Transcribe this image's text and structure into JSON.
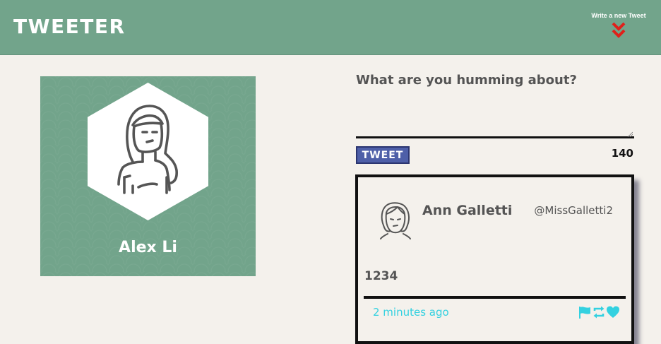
{
  "header": {
    "brand": "TWEETER",
    "compose_label": "Write a new Tweet",
    "compose_icon": "double-chevron-down-icon",
    "background_color": "#72a48b",
    "accent_color": "#e0201a"
  },
  "profile": {
    "name": "Alex Li",
    "avatar_icon": "user-avatar-icon",
    "background_color": "#72a48b"
  },
  "composer": {
    "prompt": "What are you humming about?",
    "input_value": "",
    "button_label": "TWEET",
    "char_count": "140"
  },
  "tweets": [
    {
      "name": "Ann Galletti",
      "handle": "@MissGalletti2",
      "body": "1234",
      "time": "2 minutes ago",
      "avatar_icon": "user-avatar-icon",
      "actions": [
        "flag-icon",
        "retweet-icon",
        "heart-icon"
      ],
      "action_color": "#33d1e0"
    }
  ]
}
